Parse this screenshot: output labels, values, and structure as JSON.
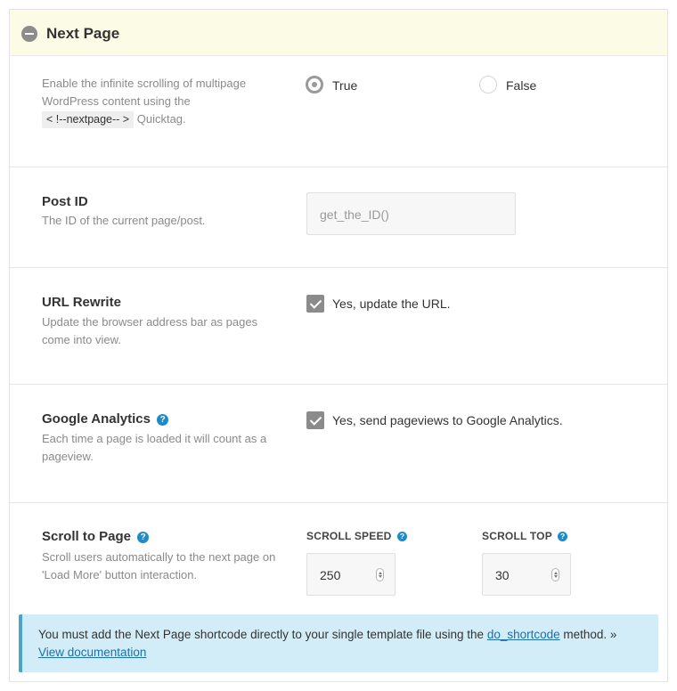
{
  "panel": {
    "title": "Next Page"
  },
  "infinite_scroll": {
    "desc_prefix": "Enable the infinite scrolling of multipage WordPress content using the",
    "code": "< !--nextpage-- >",
    "desc_suffix": "Quicktag.",
    "options": [
      {
        "label": "True",
        "checked": true
      },
      {
        "label": "False",
        "checked": false
      }
    ]
  },
  "post_id": {
    "label": "Post ID",
    "desc": "The ID of the current page/post.",
    "placeholder": "get_the_ID()"
  },
  "url_rewrite": {
    "label": "URL Rewrite",
    "desc": "Update the browser address bar as pages come into view.",
    "checkbox_label": "Yes, update the URL.",
    "checked": true
  },
  "google_analytics": {
    "label": "Google Analytics",
    "desc": "Each time a page is loaded it will count as a pageview.",
    "checkbox_label": "Yes, send pageviews to Google Analytics.",
    "checked": true
  },
  "scroll_to_page": {
    "label": "Scroll to Page",
    "desc": "Scroll users automatically to the next page on 'Load More' button interaction.",
    "speed_label": "SCROLL SPEED",
    "speed_value": "250",
    "top_label": "SCROLL TOP",
    "top_value": "30"
  },
  "notice": {
    "text_before": "You must add the Next Page shortcode directly to your single template file using the",
    "link1": "do_shortcode",
    "text_after": "method. »",
    "link2": "View documentation"
  },
  "icons": {
    "help": "?",
    "accent_color": "#1f8ac9",
    "header_bg": "#fcfbe5",
    "notice_bg": "#d2edf8"
  }
}
